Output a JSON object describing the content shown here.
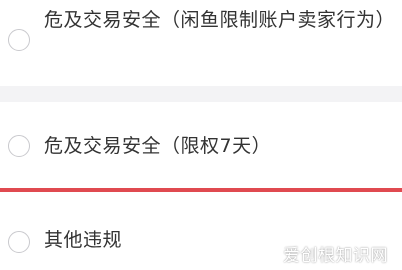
{
  "options": [
    {
      "label": "危及交易安全（闲鱼限制账户卖家行为）",
      "selected": false
    },
    {
      "label": "危及交易安全（限权7天）",
      "selected": false
    },
    {
      "label": "其他违规",
      "selected": false,
      "highlighted": true
    }
  ],
  "watermark": "爱创根知识网",
  "colors": {
    "accent": "#e04a50",
    "separator": "#f3f3f5",
    "text": "#333333",
    "radio_border": "#c9c9cd"
  }
}
